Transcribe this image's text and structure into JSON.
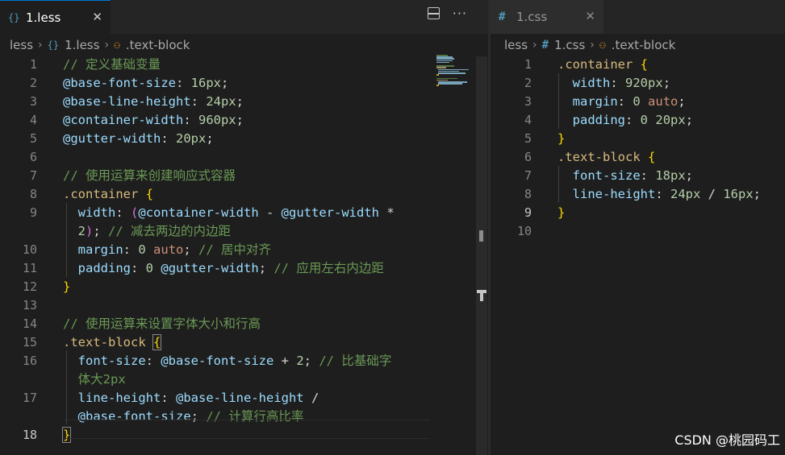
{
  "left": {
    "tab": {
      "icon": "{}",
      "label": "1.less",
      "close": "✕"
    },
    "actions": {
      "more": "···"
    },
    "breadcrumb": [
      "less",
      "1.less",
      ".text-block"
    ],
    "lines": [
      {
        "n": "1",
        "html": "<span class=\"c-comment\">// 定义基础变量</span>"
      },
      {
        "n": "2",
        "html": "<span class=\"c-var\">@base-font-size</span><span class=\"c-text\">: </span><span class=\"c-num\">16px</span><span class=\"c-text\">;</span>"
      },
      {
        "n": "3",
        "html": "<span class=\"c-var\">@base-line-height</span><span class=\"c-text\">: </span><span class=\"c-num\">24px</span><span class=\"c-text\">;</span>"
      },
      {
        "n": "4",
        "html": "<span class=\"c-var\">@container-width</span><span class=\"c-text\">: </span><span class=\"c-num\">960px</span><span class=\"c-text\">;</span>"
      },
      {
        "n": "5",
        "html": "<span class=\"c-var\">@gutter-width</span><span class=\"c-text\">: </span><span class=\"c-num\">20px</span><span class=\"c-text\">;</span>"
      },
      {
        "n": "6",
        "html": ""
      },
      {
        "n": "7",
        "html": "<span class=\"c-comment\">// 使用运算来创建响应式容器</span>"
      },
      {
        "n": "8",
        "html": "<span class=\"c-sel\">.container</span><span class=\"c-text\"> </span><span class=\"c-brace\">{</span>"
      },
      {
        "n": "9",
        "html": "  <span class=\"c-prop\">width</span><span class=\"c-text\">: </span><span class=\"c-paren\">(</span><span class=\"c-var\">@container-width</span><span class=\"c-text\"> - </span><span class=\"c-var\">@gutter-width</span><span class=\"c-text\"> *</span>"
      },
      {
        "n": "",
        "html": "  <span class=\"c-num\">2</span><span class=\"c-paren\">)</span><span class=\"c-text\">; </span><span class=\"c-comment\">// 减去两边的内边距</span>"
      },
      {
        "n": "10",
        "html": "  <span class=\"c-prop\">margin</span><span class=\"c-text\">: </span><span class=\"c-num\">0</span><span class=\"c-text\"> </span><span class=\"c-kw\">auto</span><span class=\"c-text\">; </span><span class=\"c-comment\">// 居中对齐</span>"
      },
      {
        "n": "11",
        "html": "  <span class=\"c-prop\">padding</span><span class=\"c-text\">: </span><span class=\"c-num\">0</span><span class=\"c-text\"> </span><span class=\"c-var\">@gutter-width</span><span class=\"c-text\">; </span><span class=\"c-comment\">// 应用左右内边距</span>"
      },
      {
        "n": "12",
        "html": "<span class=\"c-brace\">}</span>"
      },
      {
        "n": "13",
        "html": ""
      },
      {
        "n": "14",
        "html": "<span class=\"c-comment\">// 使用运算来设置字体大小和行高</span>"
      },
      {
        "n": "15",
        "html": "<span class=\"c-sel\">.text-block</span><span class=\"c-text\"> </span><span class=\"c-brace brace-box\">{</span>"
      },
      {
        "n": "16",
        "html": "  <span class=\"c-prop\">font-size</span><span class=\"c-text\">: </span><span class=\"c-var\">@base-font-size</span><span class=\"c-text\"> + </span><span class=\"c-num\">2</span><span class=\"c-text\">; </span><span class=\"c-comment\">// 比基础字</span>"
      },
      {
        "n": "",
        "html": "  <span class=\"c-comment\">体大2px</span>"
      },
      {
        "n": "17",
        "html": "  <span class=\"c-prop\">line-height</span><span class=\"c-text\">: </span><span class=\"c-var\">@base-line-height</span><span class=\"c-text\"> /</span>"
      },
      {
        "n": "",
        "html": "  <span class=\"c-var\">@base-font-size</span><span class=\"c-text\">; </span><span class=\"c-comment\">// 计算行高比率</span>"
      },
      {
        "n": "18",
        "html": "<span class=\"c-brace brace-box\">}</span>"
      }
    ]
  },
  "right": {
    "tab": {
      "icon": "#",
      "label": "1.css",
      "close": "✕"
    },
    "breadcrumb": [
      "less",
      "1.css",
      ".text-block"
    ],
    "lines": [
      {
        "n": "1",
        "html": "<span class=\"c-sel\">.container</span><span class=\"c-text\"> </span><span class=\"c-brace\">{</span>"
      },
      {
        "n": "2",
        "html": "  <span class=\"c-prop\">width</span><span class=\"c-text\">: </span><span class=\"c-num\">920px</span><span class=\"c-text\">;</span>"
      },
      {
        "n": "3",
        "html": "  <span class=\"c-prop\">margin</span><span class=\"c-text\">: </span><span class=\"c-num\">0</span><span class=\"c-text\"> </span><span class=\"c-kw\">auto</span><span class=\"c-text\">;</span>"
      },
      {
        "n": "4",
        "html": "  <span class=\"c-prop\">padding</span><span class=\"c-text\">: </span><span class=\"c-num\">0</span><span class=\"c-text\"> </span><span class=\"c-num\">20px</span><span class=\"c-text\">;</span>"
      },
      {
        "n": "5",
        "html": "<span class=\"c-brace\">}</span>"
      },
      {
        "n": "6",
        "html": "<span class=\"c-sel\">.text-block</span><span class=\"c-text\"> </span><span class=\"c-brace\">{</span>"
      },
      {
        "n": "7",
        "html": "  <span class=\"c-prop\">font-size</span><span class=\"c-text\">: </span><span class=\"c-num\">18px</span><span class=\"c-text\">;</span>"
      },
      {
        "n": "8",
        "html": "  <span class=\"c-prop\">line-height</span><span class=\"c-text\">: </span><span class=\"c-num\">24px</span><span class=\"c-text\"> / </span><span class=\"c-num\">16px</span><span class=\"c-text\">;</span>"
      },
      {
        "n": "9",
        "html": "<span class=\"c-brace\">}</span>"
      },
      {
        "n": "10",
        "html": ""
      }
    ]
  },
  "watermark": "CSDN @桃园码工"
}
